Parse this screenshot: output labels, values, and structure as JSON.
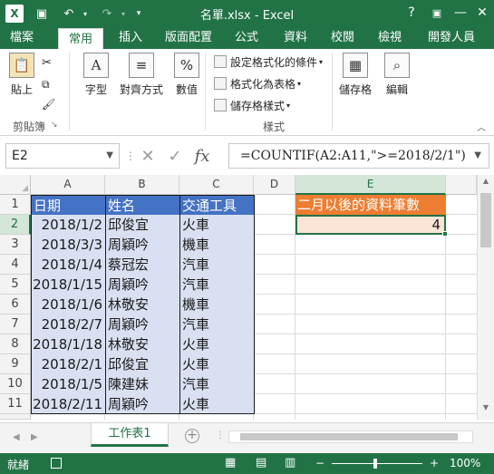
{
  "titlebar": {
    "title": "名單.xlsx - Excel",
    "help": "?",
    "minimize": "—",
    "close": "✕"
  },
  "ribbon_tabs": [
    "檔案",
    "常用",
    "插入",
    "版面配置",
    "公式",
    "資料",
    "校閱",
    "檢視",
    "開發人員"
  ],
  "active_tab": "常用",
  "ribbon": {
    "paste_label": "貼上",
    "clipboard_group": "剪貼簿",
    "font_label": "字型",
    "align_label": "對齊方式",
    "number_label": "數值",
    "conditional_format": "設定格式化的條件",
    "format_as_table": "格式化為表格",
    "cell_styles": "儲存格樣式",
    "styles_group": "樣式",
    "cells_label": "儲存格",
    "edit_label": "編輯"
  },
  "formula_bar": {
    "name_box": "E2",
    "formula": "=COUNTIF(A2:A11,\">=2018/2/1\")",
    "fx": "fx"
  },
  "columns": [
    "A",
    "B",
    "C",
    "D",
    "E"
  ],
  "selected_column": "E",
  "rows": [
    "1",
    "2",
    "3",
    "4",
    "5",
    "6",
    "7",
    "8",
    "9",
    "10",
    "11"
  ],
  "selected_row": "2",
  "table": {
    "headers": [
      "日期",
      "姓名",
      "交通工具"
    ],
    "data": [
      [
        "2018/1/2",
        "邱俊宜",
        "火車"
      ],
      [
        "2018/3/3",
        "周穎吟",
        "機車"
      ],
      [
        "2018/1/4",
        "蔡冠宏",
        "汽車"
      ],
      [
        "2018/1/15",
        "周穎吟",
        "汽車"
      ],
      [
        "2018/1/6",
        "林敬安",
        "機車"
      ],
      [
        "2018/2/7",
        "周穎吟",
        "汽車"
      ],
      [
        "2018/1/18",
        "林敬安",
        "火車"
      ],
      [
        "2018/2/1",
        "邱俊宜",
        "火車"
      ],
      [
        "2018/1/5",
        "陳建妹",
        "汽車"
      ],
      [
        "2018/2/11",
        "周穎吟",
        "火車"
      ]
    ]
  },
  "summary": {
    "label": "二月以後的資料筆數",
    "value": "4",
    "label_bg": "#ed7d31",
    "value_bg": "#fce4d6"
  },
  "sheet_tab": "工作表1",
  "status": {
    "ready": "就緒",
    "zoom": "100%"
  },
  "colors": {
    "excel_green": "#217346",
    "table_header": "#4472c4",
    "table_body": "#d9e0f1"
  }
}
